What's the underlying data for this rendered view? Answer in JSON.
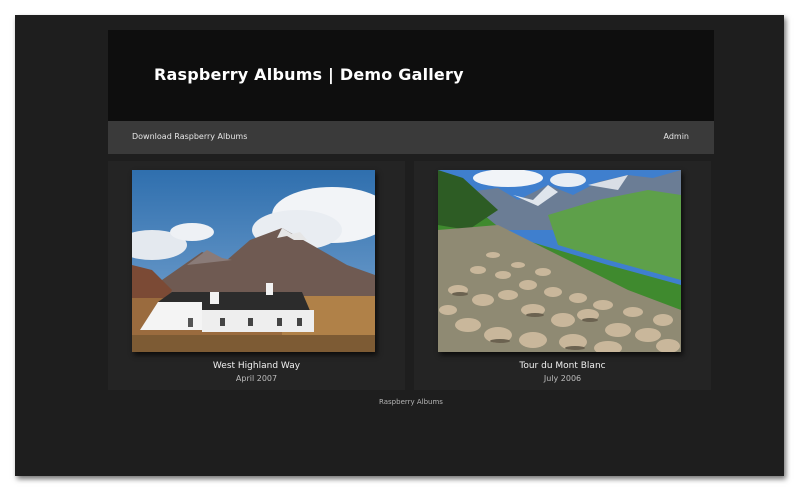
{
  "header": {
    "title": "Raspberry Albums | Demo Gallery"
  },
  "nav": {
    "download_label": "Download Raspberry Albums",
    "admin_label": "Admin"
  },
  "albums": [
    {
      "title": "West Highland Way",
      "date": "April 2007",
      "thumbnail": "cottage-mountain-photo"
    },
    {
      "title": "Tour du Mont Blanc",
      "date": "July 2006",
      "thumbnail": "sheep-valley-photo"
    }
  ],
  "footer": {
    "text": "Raspberry Albums"
  },
  "colors": {
    "page_bg": "#1e1e1e",
    "header_bg": "#0e0e0e",
    "nav_bg": "#3a3a3a",
    "card_bg": "#242424"
  }
}
